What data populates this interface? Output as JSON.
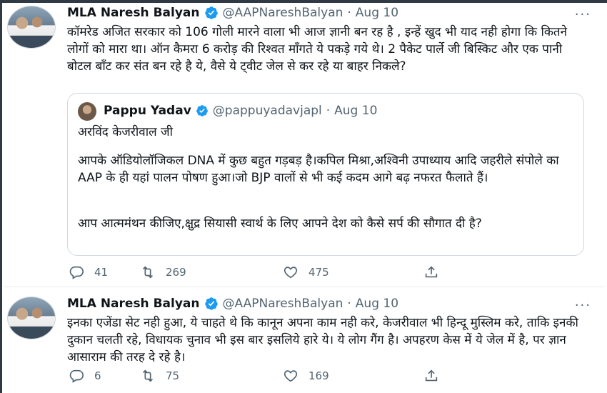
{
  "tweets": [
    {
      "author": {
        "name": "MLA Naresh Balyan",
        "handle": "@AAPNareshBalyan"
      },
      "date": "Aug 10",
      "more": "···",
      "text": "कॉमरेड अजित सरकार को 106 गोली मारने वाला भी आज ज्ञानी बन रह है , इन्हें खुद भी याद नही होगा कि कितने लोगों को मारा था। ऑन कैमरा 6 करोड़ की रिश्वत माँगते ये पकड़े गये थे। 2 पैकेट पार्ले जी बिस्किट और एक पानी बोटल बाँट कर संत बन रहे है ये, वैसे ये ट्वीट जेल से कर रहे या बाहर निकले?",
      "quoted": {
        "author": {
          "name": "Pappu Yadav",
          "handle": "@pappuyadavjapl"
        },
        "date": "Aug 10",
        "lines": [
          "अरविंद केजरीवाल जी",
          "आपके ऑडियोलॉजिकल DNA में कुछ बहुत गड़बड़ है।कपिल मिश्रा,अश्विनी उपाध्याय आदि जहरीले संपोले का AAP के ही यहां पालन पोषण हुआ।जो BJP वालों से भी कई कदम आगे बढ़ नफरत फैलाते हैं।",
          "आप आत्ममंथन कीजिए,क्षुद्र सियासी स्वार्थ के लिए आपने देश को कैसे सर्प की सौगात दी है?"
        ]
      },
      "stats": {
        "replies": "41",
        "retweets": "269",
        "likes": "475"
      }
    },
    {
      "author": {
        "name": "MLA Naresh Balyan",
        "handle": "@AAPNareshBalyan"
      },
      "date": "Aug 10",
      "more": "···",
      "text": "इनका एजेंडा सेट नही हुआ, ये चाहते थे कि कानून अपना काम नही करे, केजरीवाल भी हिन्दू मुस्लिम करे, ताकि इनकी दुकान चलती रहे, विधायक चुनाव भी इस बार इसलिये हारे ये। ये लोग गैंग है। अपहरण केस में ये जेल में है, पर ज्ञान आसाराम की तरह दे रहे है।",
      "stats": {
        "replies": "6",
        "retweets": "75",
        "likes": "169"
      }
    }
  ],
  "separator": "·",
  "colors": {
    "text": "#0f1419",
    "muted": "#536471",
    "verified": "#1d9bf0",
    "border": "#cfd9de"
  },
  "icons": [
    "verified-badge-icon",
    "more-icon",
    "reply-icon",
    "retweet-icon",
    "like-icon",
    "share-icon"
  ]
}
